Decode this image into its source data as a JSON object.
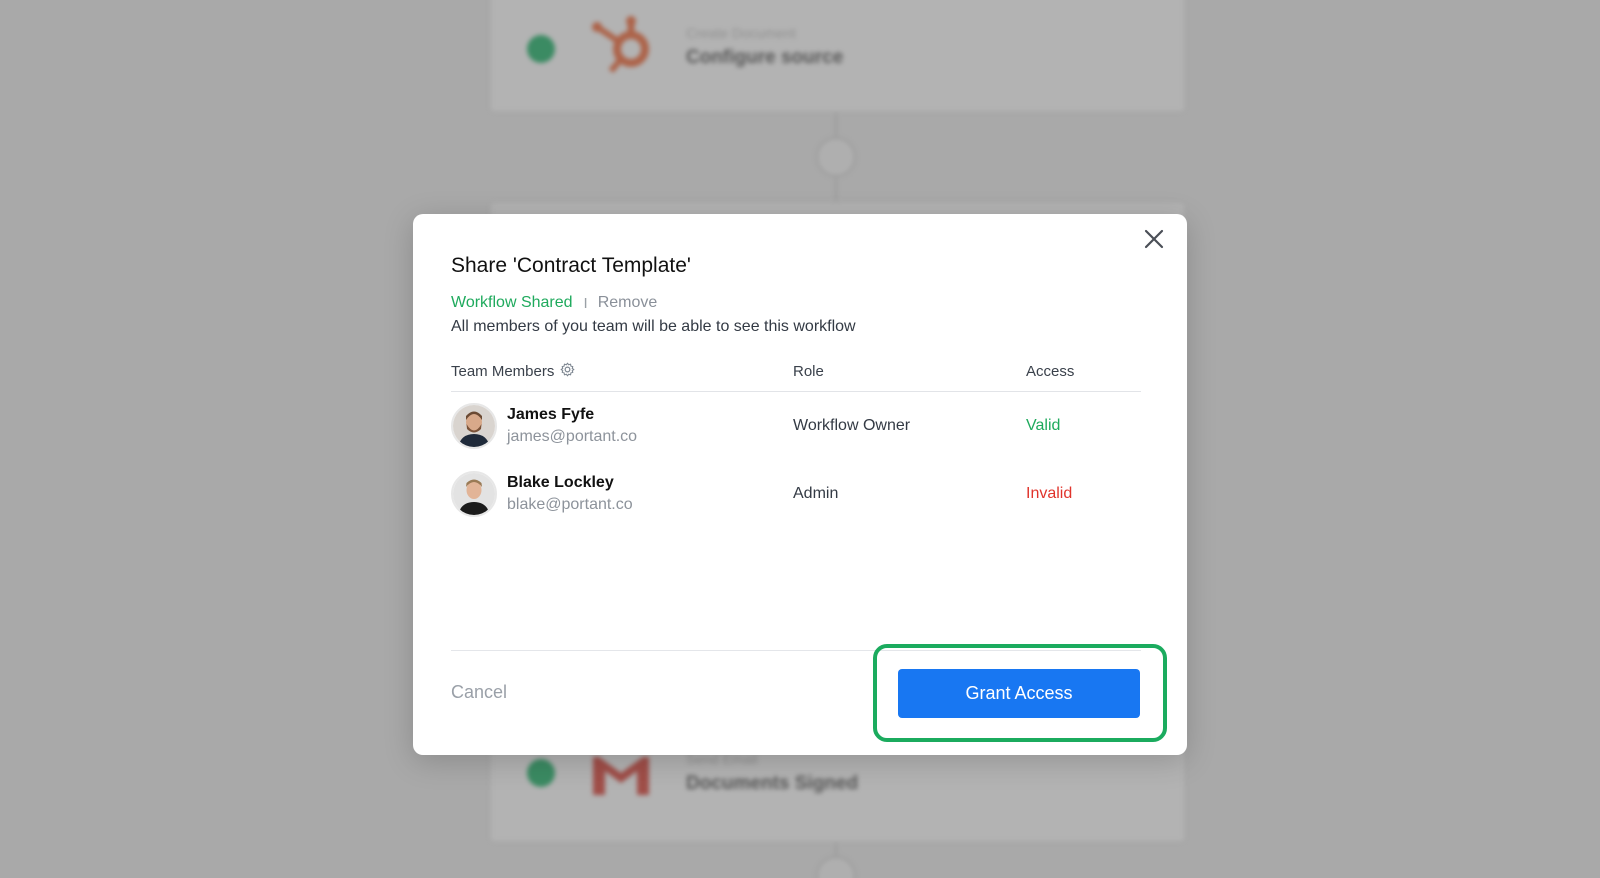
{
  "background": {
    "top_step": {
      "subtitle": "Create Document",
      "title": "Configure source"
    },
    "bottom_step": {
      "subtitle": "Send Email",
      "title": "Documents Signed"
    }
  },
  "modal": {
    "title": "Share 'Contract Template'",
    "shared_status": "Workflow Shared",
    "separator": "I",
    "remove_label": "Remove",
    "description": "All members of you team will be able to see this workflow",
    "columns": {
      "members": "Team Members",
      "role": "Role",
      "access": "Access"
    },
    "members": [
      {
        "name": "James Fyfe",
        "email": "james@portant.co",
        "role": "Workflow Owner",
        "access": "Valid"
      },
      {
        "name": "Blake Lockley",
        "email": "blake@portant.co",
        "role": "Admin",
        "access": "Invalid"
      }
    ],
    "cancel_label": "Cancel",
    "grant_label": "Grant Access"
  },
  "colors": {
    "accent_green": "#1faa5d",
    "invalid_red": "#e0342c",
    "primary_blue": "#1877f2",
    "highlight_green": "#1bab5e"
  },
  "icons": [
    "close-icon",
    "gear-icon",
    "hubspot-icon",
    "gmail-icon"
  ]
}
